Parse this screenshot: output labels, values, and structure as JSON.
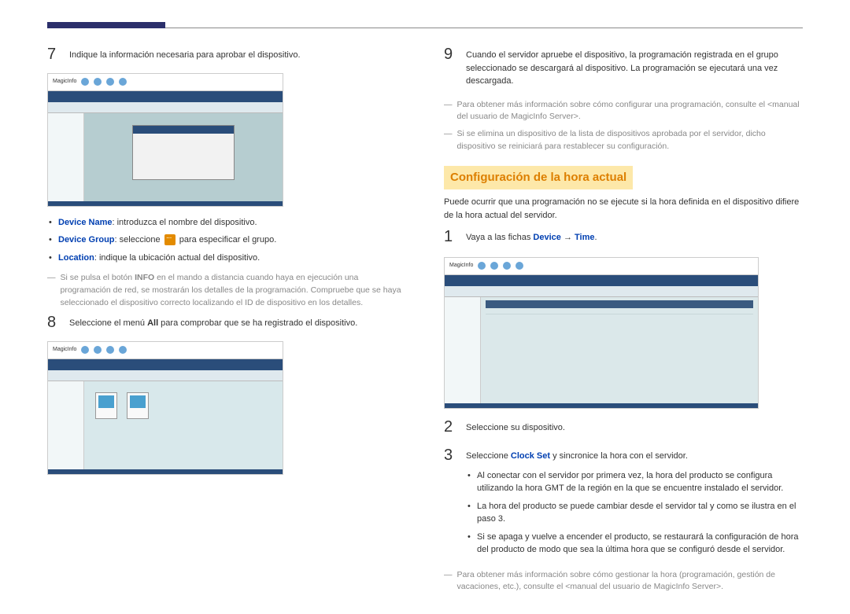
{
  "col1": {
    "step7": {
      "num": "7",
      "text": "Indique la información necesaria para aprobar el dispositivo.",
      "bullets": {
        "b1_label": "Device Name",
        "b1_text": ": introduzca el nombre del dispositivo.",
        "b2_label": "Device Group",
        "b2_text_a": ": seleccione ",
        "b2_text_b": " para especificar el grupo.",
        "b3_label": "Location",
        "b3_text": ": indique la ubicación actual del dispositivo."
      },
      "note_a": "Si se pulsa el botón ",
      "note_bold": "INFO",
      "note_b": " en el mando a distancia cuando haya en ejecución una programación de red, se mostrarán los detalles de la programación. Compruebe que se haya seleccionado el dispositivo correcto localizando el ID de dispositivo en los detalles."
    },
    "step8": {
      "num": "8",
      "text_a": "Seleccione el menú ",
      "text_bold": "All",
      "text_b": " para comprobar que se ha registrado el dispositivo."
    },
    "shot_label": "MagicInfo"
  },
  "col2": {
    "step9": {
      "num": "9",
      "text": "Cuando el servidor apruebe el dispositivo, la programación registrada en el grupo seleccionado se descargará al dispositivo. La programación se ejecutará una vez descargada.",
      "note1": "Para obtener más información sobre cómo configurar una programación, consulte el <manual del usuario de MagicInfo Server>.",
      "note2": "Si se elimina un dispositivo de la lista de dispositivos aprobada por el servidor, dicho dispositivo se reiniciará para restablecer su configuración."
    },
    "section_title": "Configuración de la hora actual",
    "section_intro": "Puede ocurrir que una programación no se ejecute si la hora definida en el dispositivo difiere de la hora actual del servidor.",
    "sub1": {
      "num": "1",
      "text_a": "Vaya a las fichas ",
      "blue1": "Device",
      "arrow": " → ",
      "blue2": "Time",
      "period": "."
    },
    "sub2": {
      "num": "2",
      "text": "Seleccione su dispositivo."
    },
    "sub3": {
      "num": "3",
      "text_a": "Seleccione ",
      "blue": "Clock Set",
      "text_b": " y sincronice la hora con el servidor.",
      "b1": "Al conectar con el servidor por primera vez, la hora del producto se configura utilizando la hora GMT de la región en la que se encuentre instalado el servidor.",
      "b2": "La hora del producto se puede cambiar desde el servidor tal y como se ilustra en el paso 3.",
      "b3": "Si se apaga y vuelve a encender el producto, se restaurará la configuración de hora del producto de modo que sea la última hora que se configuró desde el servidor.",
      "note": "Para obtener más información sobre cómo gestionar la hora (programación, gestión de vacaciones, etc.), consulte el <manual del usuario de MagicInfo Server>."
    }
  }
}
